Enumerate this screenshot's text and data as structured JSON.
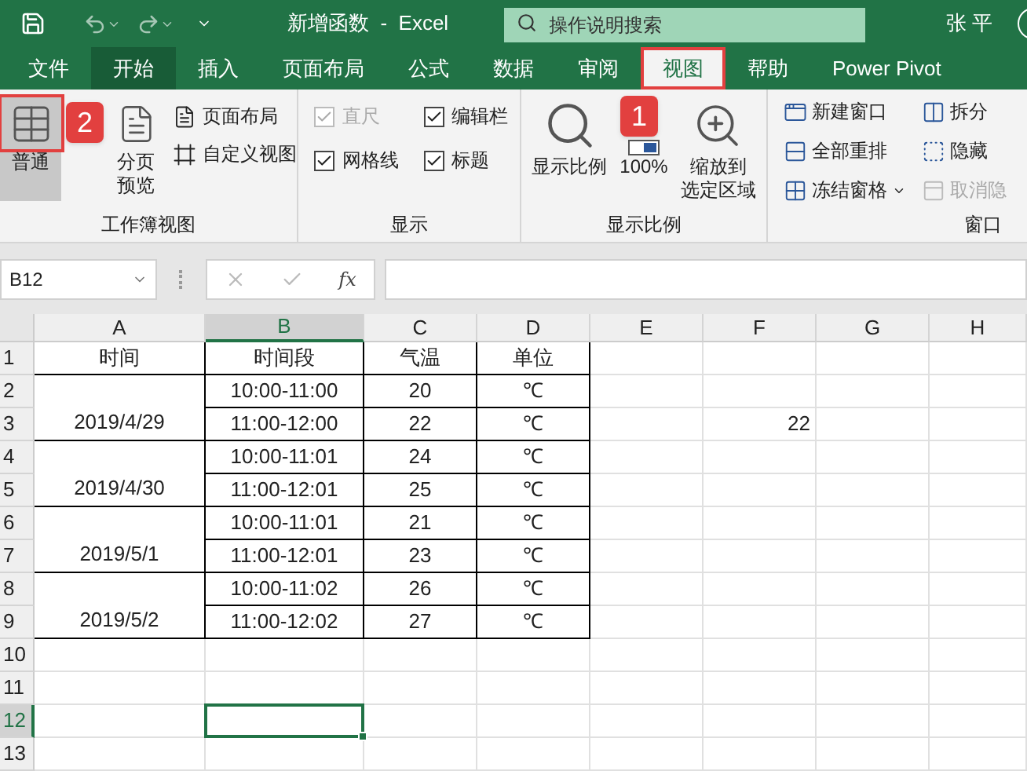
{
  "title_bar": {
    "title": "新增函数  -  Excel",
    "search": {
      "placeholder": "操作说明搜索"
    },
    "user": "张 平"
  },
  "tabs": [
    {
      "label": "文件",
      "selected": false,
      "hovered": false
    },
    {
      "label": "开始",
      "selected": false,
      "hovered": true
    },
    {
      "label": "插入",
      "selected": false,
      "hovered": false
    },
    {
      "label": "页面布局",
      "selected": false,
      "hovered": false
    },
    {
      "label": "公式",
      "selected": false,
      "hovered": false
    },
    {
      "label": "数据",
      "selected": false,
      "hovered": false
    },
    {
      "label": "审阅",
      "selected": false,
      "hovered": false
    },
    {
      "label": "视图",
      "selected": true,
      "hovered": false
    },
    {
      "label": "帮助",
      "selected": false,
      "hovered": false
    },
    {
      "label": "Power Pivot",
      "selected": false,
      "hovered": false
    }
  ],
  "ribbon": {
    "workbook_views": {
      "label": "工作簿视图",
      "large": [
        {
          "label_lines": [
            "普通"
          ],
          "selected": true
        },
        {
          "label_lines": [
            "分页",
            "预览"
          ],
          "selected": false
        }
      ],
      "small": [
        {
          "label": "页面布局",
          "kind": "page"
        },
        {
          "label": "自定义视图",
          "kind": "custom"
        }
      ]
    },
    "show": {
      "label": "显示",
      "checkboxes": [
        {
          "label": "直尺",
          "checked": true,
          "disabled": true
        },
        {
          "label": "编辑栏",
          "checked": true,
          "disabled": false
        },
        {
          "label": "网格线",
          "checked": true,
          "disabled": false
        },
        {
          "label": "标题",
          "checked": true,
          "disabled": false
        }
      ]
    },
    "zoom": {
      "label": "显示比例",
      "buttons": [
        {
          "label_lines": [
            "显示比例"
          ],
          "kind": "zoom"
        },
        {
          "label_lines": [
            "100%"
          ],
          "kind": "hundred"
        },
        {
          "label_lines": [
            "缩放到",
            "选定区域"
          ],
          "kind": "fit"
        }
      ]
    },
    "window": {
      "label": "窗口",
      "items": [
        {
          "label": "新建窗口",
          "kind": "new",
          "disabled": false,
          "dropdown": false
        },
        {
          "label": "全部重排",
          "kind": "arrange",
          "disabled": false,
          "dropdown": false
        },
        {
          "label": "冻结窗格",
          "kind": "freeze",
          "disabled": false,
          "dropdown": true
        },
        {
          "label": "拆分",
          "kind": "split",
          "disabled": false,
          "dropdown": false
        },
        {
          "label": "隐藏",
          "kind": "hide",
          "disabled": false,
          "dropdown": false
        },
        {
          "label": "取消隐",
          "kind": "unhide",
          "disabled": true,
          "dropdown": false
        }
      ]
    }
  },
  "annotations": [
    {
      "label": "2"
    },
    {
      "label": "1"
    }
  ],
  "formula_bar": {
    "name_box": "B12",
    "function_label": "fx"
  },
  "sheet": {
    "columns": [
      {
        "label": "A",
        "selected": false
      },
      {
        "label": "B",
        "selected": true
      },
      {
        "label": "C",
        "selected": false
      },
      {
        "label": "D",
        "selected": false
      },
      {
        "label": "E",
        "selected": false
      },
      {
        "label": "F",
        "selected": false
      },
      {
        "label": "G",
        "selected": false
      },
      {
        "label": "H",
        "selected": false
      }
    ],
    "rows": [
      {
        "label": "1",
        "selected": false
      },
      {
        "label": "2",
        "selected": false
      },
      {
        "label": "3",
        "selected": false
      },
      {
        "label": "4",
        "selected": false
      },
      {
        "label": "5",
        "selected": false
      },
      {
        "label": "6",
        "selected": false
      },
      {
        "label": "7",
        "selected": false
      },
      {
        "label": "8",
        "selected": false
      },
      {
        "label": "9",
        "selected": false
      },
      {
        "label": "10",
        "selected": false
      },
      {
        "label": "11",
        "selected": false
      },
      {
        "label": "12",
        "selected": true
      },
      {
        "label": "13",
        "selected": false
      }
    ],
    "header": [
      "时间",
      "时间段",
      "气温",
      "单位"
    ],
    "records": [
      {
        "date": "2019/4/29",
        "slots": [
          {
            "period": "10:00-11:00",
            "temp": "20",
            "unit": "℃"
          },
          {
            "period": "11:00-12:00",
            "temp": "22",
            "unit": "℃",
            "column_f": "22"
          }
        ]
      },
      {
        "date": "2019/4/30",
        "slots": [
          {
            "period": "10:00-11:01",
            "temp": "24",
            "unit": "℃"
          },
          {
            "period": "11:00-12:01",
            "temp": "25",
            "unit": "℃"
          }
        ]
      },
      {
        "date": "2019/5/1",
        "slots": [
          {
            "period": "10:00-11:01",
            "temp": "21",
            "unit": "℃"
          },
          {
            "period": "11:00-12:01",
            "temp": "23",
            "unit": "℃"
          }
        ]
      },
      {
        "date": "2019/5/2",
        "slots": [
          {
            "period": "10:00-11:02",
            "temp": "26",
            "unit": "℃"
          },
          {
            "period": "11:00-12:02",
            "temp": "27",
            "unit": "℃"
          }
        ]
      }
    ]
  }
}
